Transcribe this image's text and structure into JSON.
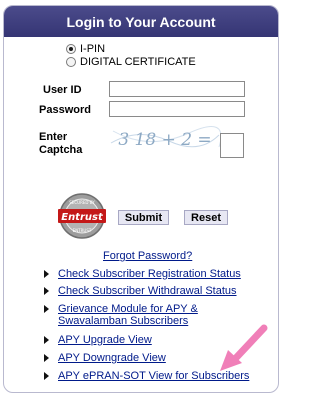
{
  "header": {
    "title": "Login to Your Account"
  },
  "auth_options": [
    {
      "label": "I-PIN",
      "selected": true
    },
    {
      "label": "DIGITAL CERTIFICATE",
      "selected": false
    }
  ],
  "form": {
    "user_id_label": "User ID",
    "user_id_value": "",
    "password_label": "Password",
    "password_value": "",
    "captcha_label": "Enter Captcha",
    "captcha_text": "3 18 + 2 =",
    "captcha_value": ""
  },
  "seal": {
    "text": "Entrust",
    "top_ring": "SECURED BY",
    "bottom_ring": "ENTRUST"
  },
  "buttons": {
    "submit": "Submit",
    "reset": "Reset"
  },
  "forgot_password": "Forgot Password?",
  "links": [
    "Check Subscriber Registration Status",
    "Check Subscriber Withdrawal Status",
    "Grievance Module for APY & Swavalamban Subscribers",
    "APY Upgrade View",
    "APY Downgrade View",
    "APY ePRAN-SOT View for Subscribers"
  ],
  "colors": {
    "header": "#3d3d7c",
    "link": "#001a8a",
    "annotation_arrow": "#f07fb8"
  }
}
